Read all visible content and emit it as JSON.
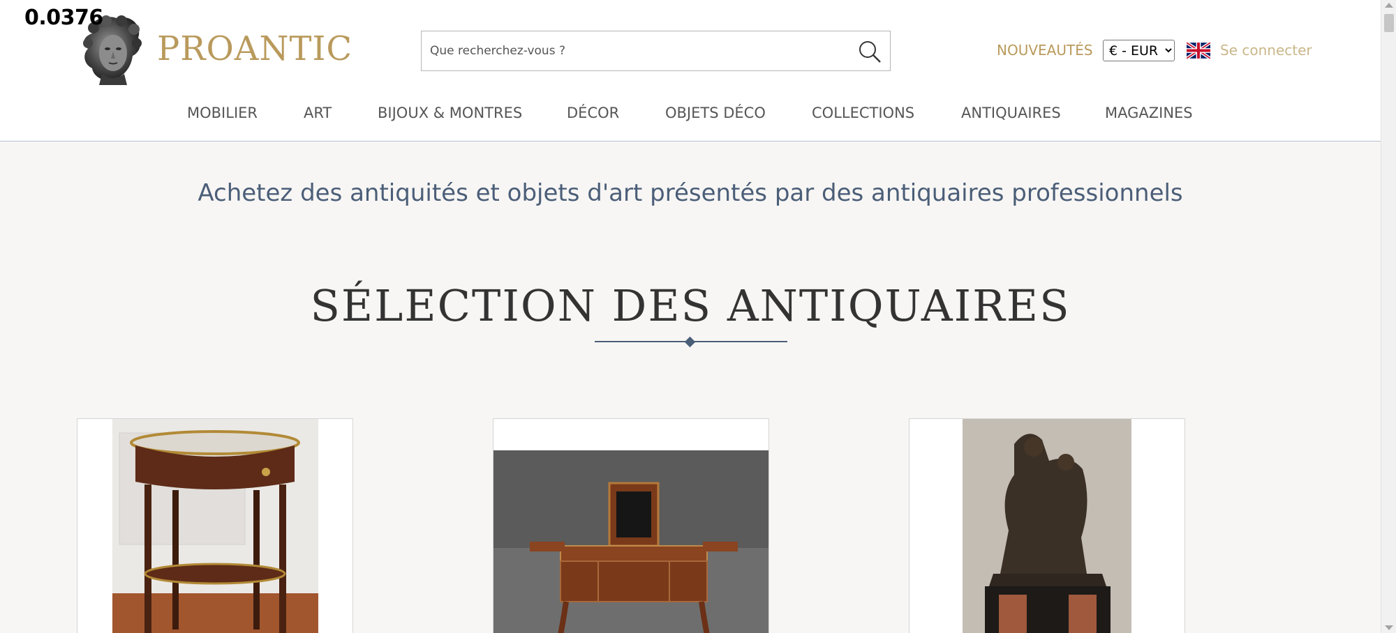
{
  "overlay": {
    "value": "0.0376"
  },
  "header": {
    "logo_text": "PROANTIC",
    "search_placeholder": "Que recherchez-vous ?",
    "nouveautes": "NOUVEAUTÉS",
    "currency": {
      "selected": "€ - EUR"
    },
    "login": "Se connecter"
  },
  "nav": {
    "items": [
      {
        "label": "MOBILIER"
      },
      {
        "label": "ART"
      },
      {
        "label": "BIJOUX & MONTRES"
      },
      {
        "label": "DÉCOR"
      },
      {
        "label": "OBJETS DÉCO"
      },
      {
        "label": "COLLECTIONS"
      },
      {
        "label": "ANTIQUAIRES"
      },
      {
        "label": "MAGAZINES"
      }
    ]
  },
  "main": {
    "tagline": "Achetez des antiquités et objets d'art présentés par des antiquaires professionnels",
    "section_title": "SÉLECTION DES ANTIQUAIRES"
  },
  "colors": {
    "gold": "#b99a5c",
    "slate": "#4b5e78",
    "background": "#f7f6f4"
  }
}
